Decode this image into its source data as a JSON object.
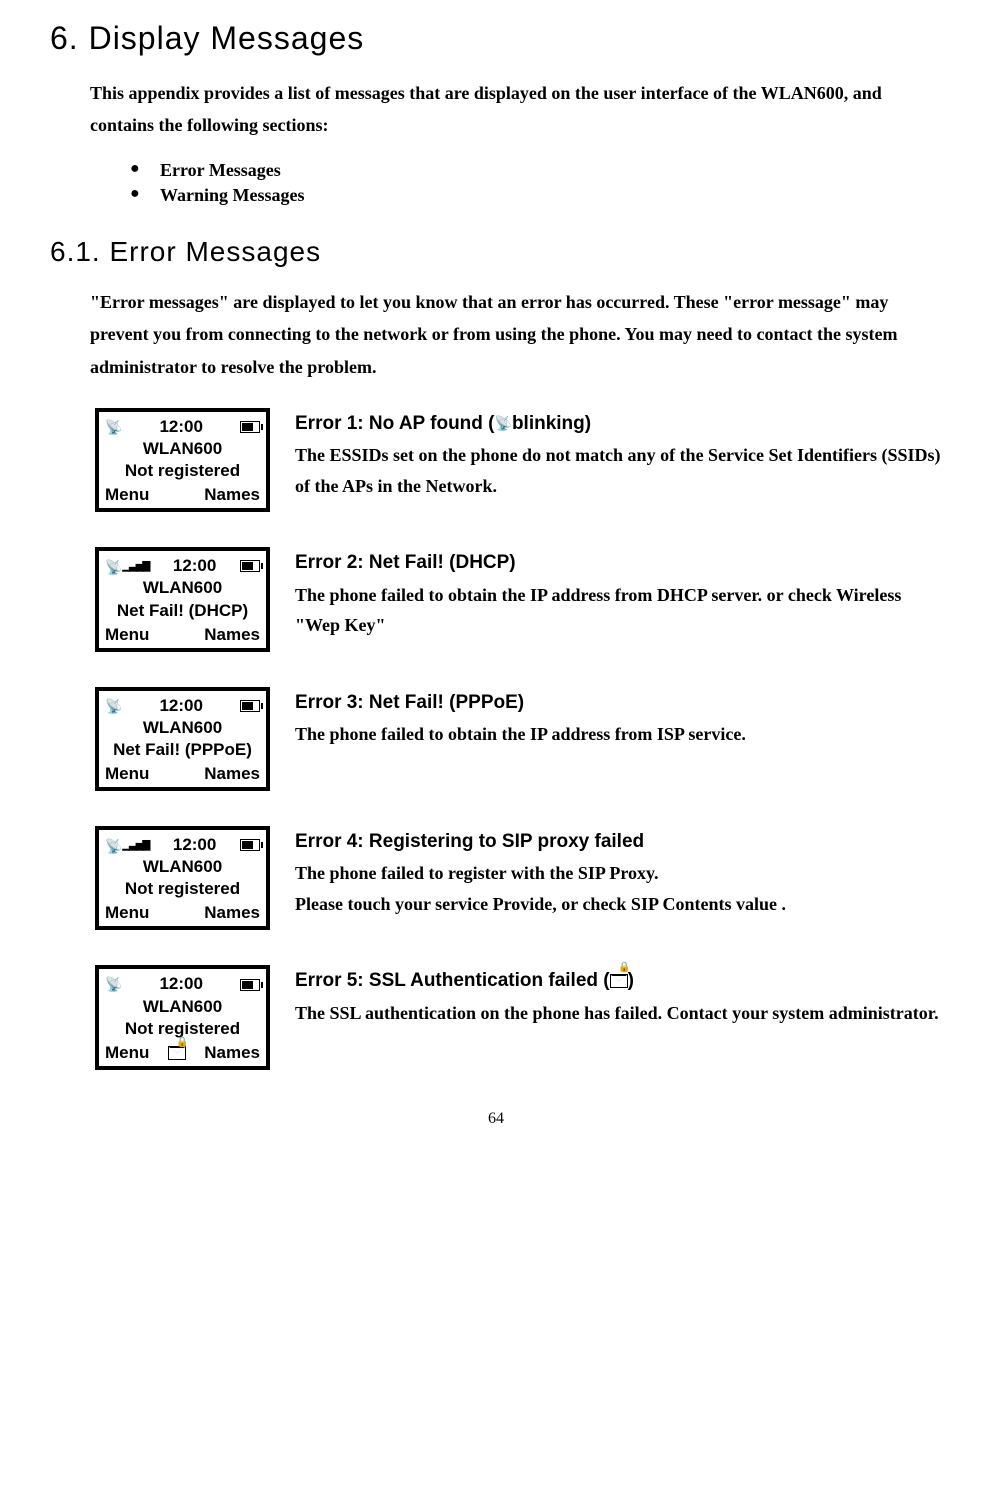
{
  "chapter_title": "6. Display Messages",
  "intro_text": "This appendix provides a list of messages that are displayed on the user interface of the WLAN600, and contains the following sections:",
  "bullets": [
    "Error Messages",
    "Warning Messages"
  ],
  "section_title": "6.1.  Error Messages",
  "section_text": "\"Error messages\" are displayed to let you know that an error has occurred. These \"error message\" may prevent you from connecting to the network or from using the phone. You may need to contact the system administrator to resolve the problem.",
  "errors": [
    {
      "screen": {
        "time": "12:00",
        "line1": "WLAN600",
        "line2": "Not registered",
        "left_softkey": "Menu",
        "right_softkey": "Names",
        "show_signal": false,
        "show_mail": false,
        "show_lock_mail": false
      },
      "title_pre": "Error 1: No AP found (",
      "title_post": "blinking)",
      "has_antenna_in_title": true,
      "desc": "The ESSIDs set on the phone do not match any of the Service Set Identifiers (SSIDs) of the APs in the Network."
    },
    {
      "screen": {
        "time": "12:00",
        "line1": "WLAN600",
        "line2": "Net Fail! (DHCP)",
        "left_softkey": "Menu",
        "right_softkey": "Names",
        "show_signal": true,
        "show_mail": false,
        "show_lock_mail": false
      },
      "title": "Error 2: Net Fail! (DHCP)",
      "desc": "The phone failed to obtain the IP address from DHCP server. or check Wireless \"Wep Key\""
    },
    {
      "screen": {
        "time": "12:00",
        "line1": "WLAN600",
        "line2": "Net Fail! (PPPoE)",
        "left_softkey": "Menu",
        "right_softkey": "Names",
        "show_signal": false,
        "show_mail": false,
        "show_lock_mail": false
      },
      "title": "Error 3: Net Fail! (PPPoE)",
      "desc": "The phone failed to obtain the IP address from ISP service."
    },
    {
      "screen": {
        "time": "12:00",
        "line1": "WLAN600",
        "line2": "Not registered",
        "left_softkey": "Menu",
        "right_softkey": "Names",
        "show_signal": true,
        "show_mail": false,
        "show_lock_mail": false
      },
      "title": "Error 4: Registering to SIP proxy failed",
      "desc": "The phone failed to register with the SIP Proxy.\nPlease touch your service Provide, or check SIP Contents value ."
    },
    {
      "screen": {
        "time": "12:00",
        "line1": "WLAN600",
        "line2": "Not registered",
        "left_softkey": "Menu",
        "right_softkey": "Names",
        "show_signal": false,
        "show_mail": true,
        "show_lock_mail": true
      },
      "title_pre": "Error 5: SSL Authentication failed (",
      "title_post": ")",
      "has_lockmail_in_title": true,
      "desc": "The SSL authentication on the phone has failed. Contact your system administrator."
    }
  ],
  "page_number": "64"
}
